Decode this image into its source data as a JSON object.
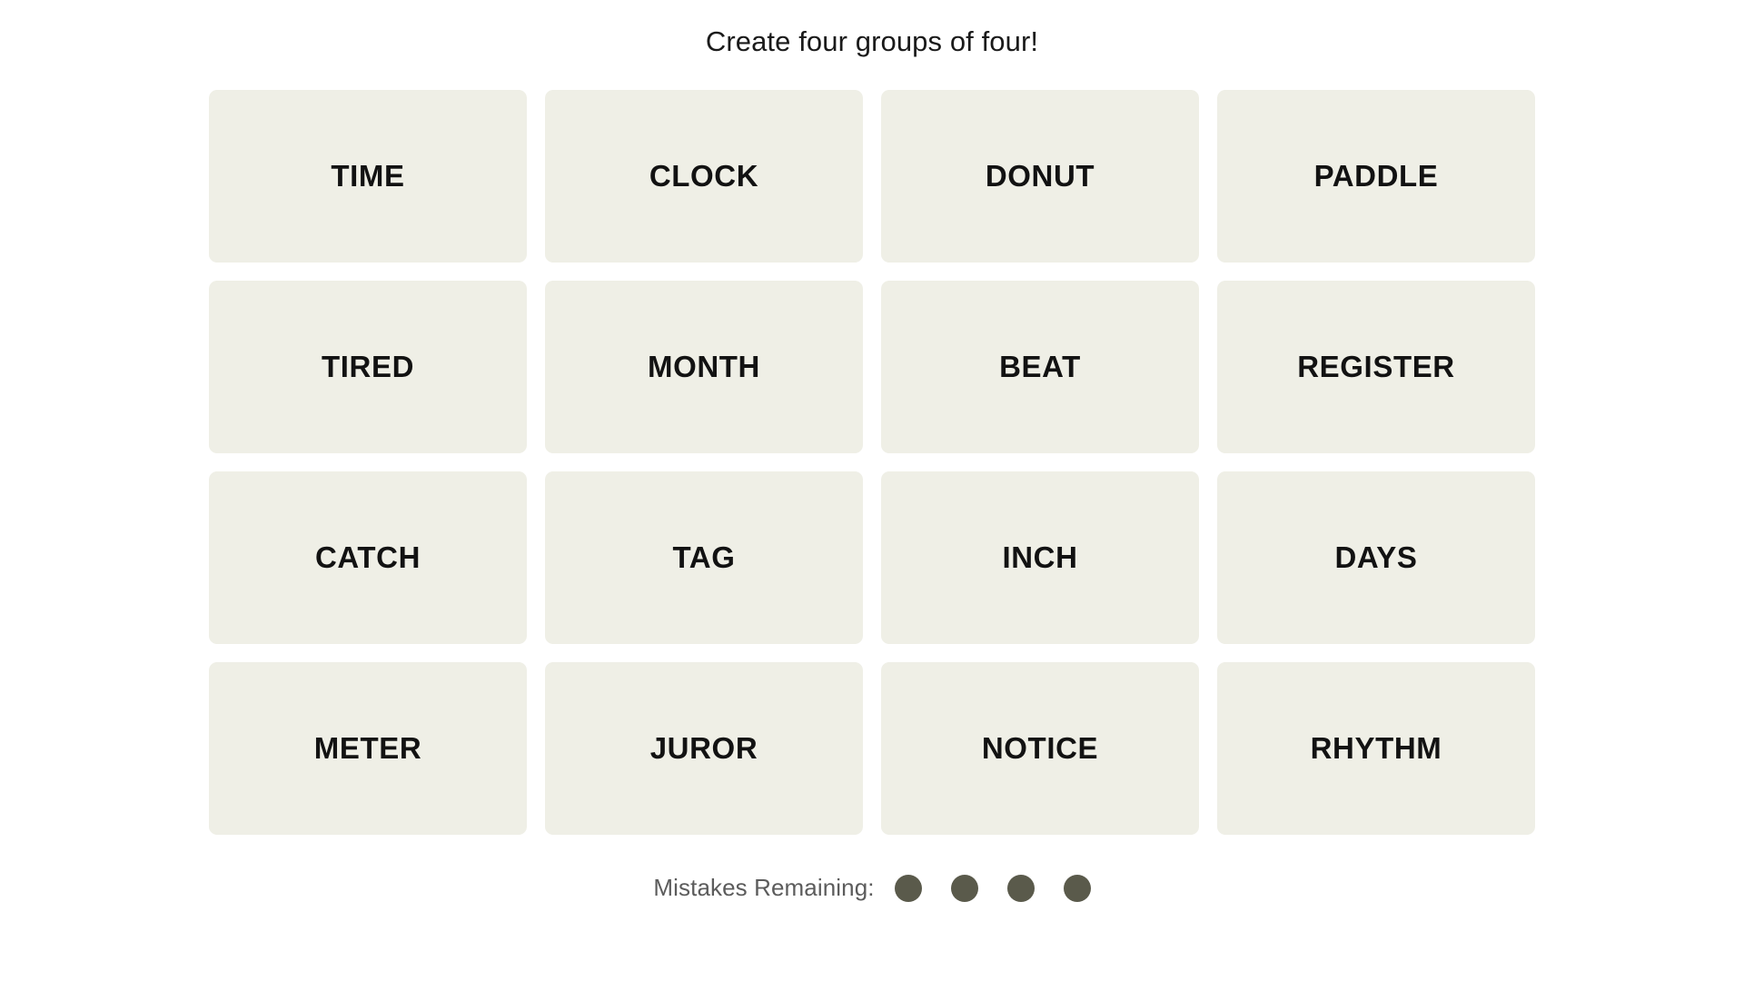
{
  "page": {
    "title": "Create four groups of four!",
    "background_color": "#FFFFFF"
  },
  "board": {
    "tile_background_color": "#EFEFE6",
    "tile_text_color": "#121212",
    "rows": [
      {
        "tiles": [
          {
            "word": "TIME"
          },
          {
            "word": "CLOCK"
          },
          {
            "word": "DONUT"
          },
          {
            "word": "PADDLE"
          }
        ]
      },
      {
        "tiles": [
          {
            "word": "TIRED"
          },
          {
            "word": "MONTH"
          },
          {
            "word": "BEAT"
          },
          {
            "word": "REGISTER"
          }
        ]
      },
      {
        "tiles": [
          {
            "word": "CATCH"
          },
          {
            "word": "TAG"
          },
          {
            "word": "INCH"
          },
          {
            "word": "DAYS"
          }
        ]
      },
      {
        "tiles": [
          {
            "word": "METER"
          },
          {
            "word": "JUROR"
          },
          {
            "word": "NOTICE"
          },
          {
            "word": "RHYTHM"
          }
        ]
      }
    ]
  },
  "mistakes": {
    "label": "Mistakes Remaining:",
    "remaining": 4,
    "dot_color": "#5A5A4B",
    "label_color": "#5C5C5C"
  }
}
